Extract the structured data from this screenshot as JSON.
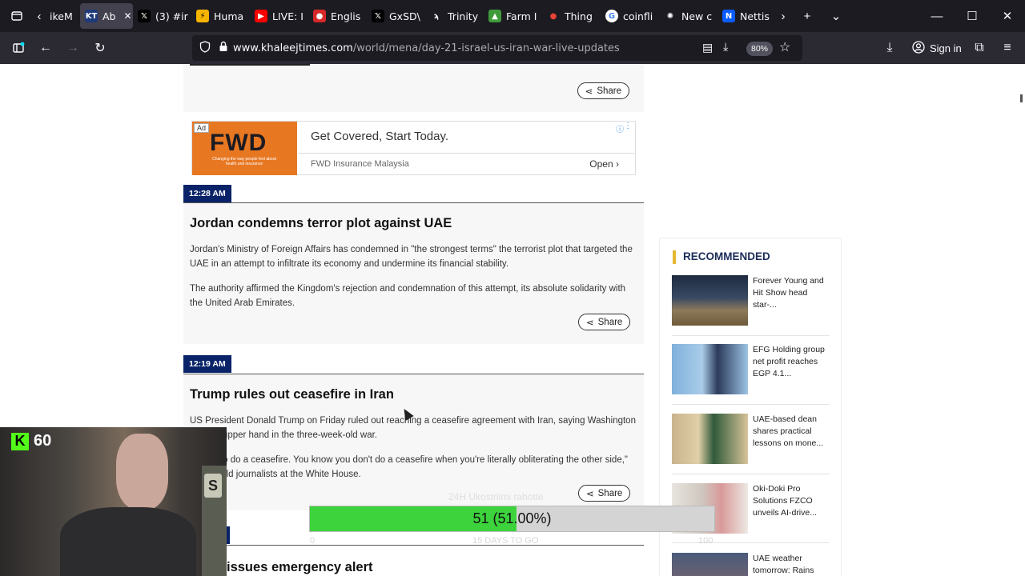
{
  "browser": {
    "tabs": [
      {
        "label": "ikeM",
        "favicon": "back-chevron"
      },
      {
        "label": "Ab",
        "favicon": "KT",
        "active": true
      },
      {
        "label": "(3) #ir",
        "favicon": "X"
      },
      {
        "label": "Huma",
        "favicon": "lightning"
      },
      {
        "label": "LIVE: I",
        "favicon": "youtube"
      },
      {
        "label": "Englis",
        "favicon": "news"
      },
      {
        "label": "GxSD\\",
        "favicon": "X"
      },
      {
        "label": "Trinity",
        "favicon": "trinity"
      },
      {
        "label": "Farm I",
        "favicon": "farm"
      },
      {
        "label": "Thing",
        "favicon": "maps-pin"
      },
      {
        "label": "coinfli",
        "favicon": "google"
      },
      {
        "label": "New c",
        "favicon": "openai"
      },
      {
        "label": "Nettis",
        "favicon": "N"
      }
    ],
    "url_domain": "www.khaleejtimes.com",
    "url_path": "/world/mena/day-21-israel-us-iran-war-live-updates",
    "zoom": "80%",
    "sign_in": "Sign in"
  },
  "page": {
    "top_card": {
      "share": "Share"
    },
    "ad": {
      "badge": "Ad",
      "logo_text": "FWD",
      "logo_tagline": "Changing the way people feel about health and insurance",
      "title": "Get Covered, Start Today.",
      "advertiser": "FWD Insurance Malaysia",
      "cta": "Open"
    },
    "updates": [
      {
        "time": "12:28 AM",
        "headline": "Jordan condemns terror plot against UAE",
        "paragraphs": [
          "Jordan's Ministry of Foreign Affairs has condemned in \"the strongest terms\" the terrorist plot that targeted the UAE in an attempt to infiltrate its economy and undermine its financial stability.",
          "The authority affirmed the Kingdom's rejection and condemnation of this attempt, its absolute solidarity with the United Arab Emirates."
        ],
        "share": "Share"
      },
      {
        "time": "12:19 AM",
        "headline": "Trump rules out ceasefire in Iran",
        "paragraphs": [
          "US President Donald Trump on Friday ruled out reaching a ceasefire agreement with Iran, saying Washington has the upper hand in the three-week-old war.",
          "\"I want to do a ceasefire. You know you don't do a ceasefire when you're literally obliterating the other side,\" Trump told journalists at the White House."
        ],
        "share": "Share"
      },
      {
        "headline": "issues emergency alert"
      }
    ],
    "recommended": {
      "title": "RECOMMENDED",
      "items": [
        {
          "text": "Forever Young and Hit Show head star-..."
        },
        {
          "text": "EFG Holding group net profit reaches EGP 4.1..."
        },
        {
          "text": "UAE-based dean shares practical lessons on mone..."
        },
        {
          "text": "Oki-Doki Pro Solutions FZCO unveils AI-drive..."
        },
        {
          "text": "UAE weather tomorrow: Rains"
        }
      ]
    }
  },
  "overlay": {
    "kick_viewers": "60",
    "goal_label": "24H Ukostriimi rahotte",
    "goal_text": "51 (51.00%)",
    "goal_progress": 0.51,
    "goal_min": "0",
    "goal_mid": "15 DAYS TO GO",
    "goal_max": "100"
  }
}
